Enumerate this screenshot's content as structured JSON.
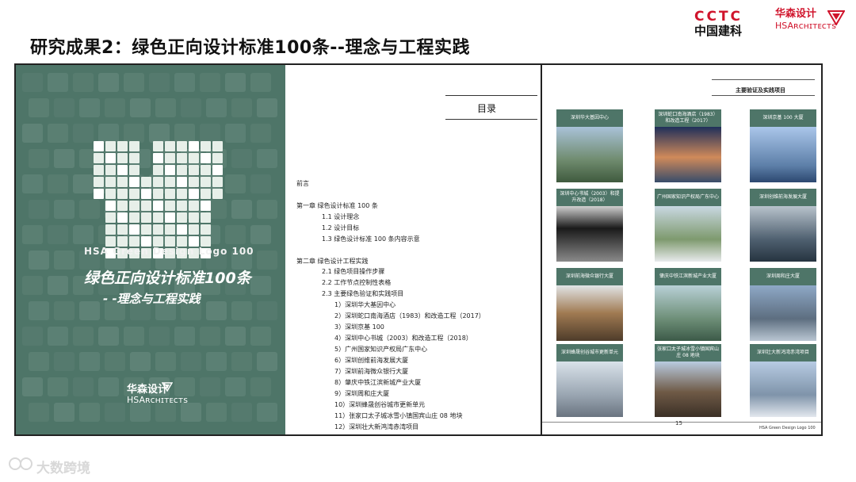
{
  "slide": {
    "title": "研究成果2：绿色正向设计标准100条--理念与工程实践"
  },
  "header_logos": {
    "cctc_top": "CCTC",
    "cctc_bottom": "中国建科",
    "hsa_cn": "华森设计",
    "hsa_en": "HSAʀᴄʜɪᴛᴇᴄᴛs"
  },
  "cover": {
    "logo_text": "HSA Green Design Logo 100",
    "title_line1": "绿色正向设计标准100条",
    "title_line2": "- -理念与工程实践",
    "brand_cn": "华森设计",
    "brand_en": "HSAʀᴄʜɪᴛᴇᴄᴛs"
  },
  "toc": {
    "heading": "目录",
    "items": [
      "前言",
      "第一章   绿色设计标准 100 条",
      "1.1  设计理念",
      "1.2  设计目标",
      "1.3  绿色设计标准 100 条内容示意",
      "第二章   绿色设计工程实践",
      "2.1  绿色项目操作步骤",
      "2.2  工作节点控制性表格",
      "2.3  主要绿色验证和实践项目",
      "1）深圳华大基因中心",
      "2）深圳蛇口南海酒店（1983）和改造工程（2017）",
      "3）深圳京基 100",
      "4）深圳中心书城（2003）和改造工程（2018）",
      "5）广州国家知识产权局广东中心",
      "6）深圳创维前海发展大厦",
      "7）深圳前海微众银行大厦",
      "8）肇庆中铁江滨新城产业大厦",
      "9）深圳周和庄大厦",
      "10）深圳蜂晟创谷城市更新单元",
      "11）张家口太子城冰雪小镇国宾山庄 08 地块",
      "12）深圳壮大新鸿湾赤湾项目"
    ]
  },
  "projects": {
    "heading": "主要验证及实践项目",
    "tiles": [
      "深圳华大基因中心",
      "深圳蛇口南海酒店（1983）和改造工程（2017）",
      "深圳京基 100 大厦",
      "深圳中心书城（2003）和提升改造（2018）",
      "广州国家知识产权局广东中心",
      "深圳创维前海发展大厦",
      "深圳前海微众银行大厦",
      "肇庆中铁江滨新城产业大厦",
      "深圳周和庄大厦",
      "深圳蜂晟创谷城市更新单元",
      "张家口太子城冰雪小镇国宾山庄 08 地块",
      "深圳壮大新鸿湾赤湾项目"
    ],
    "page_number": "15",
    "footer": "HSA Green Design Logo 100"
  },
  "watermark": {
    "text": "大数跨境"
  },
  "colors": {
    "cover_green": "#4e7568",
    "brand_red": "#d0142c"
  }
}
